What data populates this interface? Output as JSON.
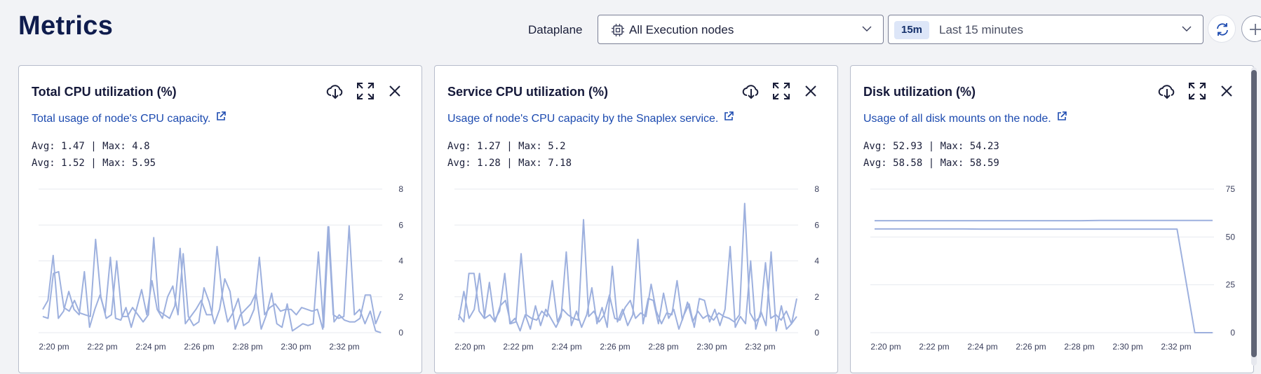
{
  "page": {
    "title": "Metrics"
  },
  "toolbar": {
    "dataplane_label": "Dataplane",
    "nodes_select": {
      "value": "All Execution nodes",
      "icon": "cpu-chip-icon"
    },
    "range_select": {
      "badge": "15m",
      "value": "Last 15 minutes"
    },
    "refresh_icon": "refresh-icon",
    "add_icon": "add-circle-icon"
  },
  "colors": {
    "line": "#9db0de",
    "grid": "#e7e9ef",
    "link": "#1d4bb0",
    "title": "#0f1c4d"
  },
  "cards": [
    {
      "title": "Total CPU utilization (%)",
      "description": "Total usage of node's CPU capacity.",
      "stats": [
        "Avg: 1.47 | Max: 4.8",
        "Avg: 1.52 | Max: 5.95"
      ],
      "tools": [
        "download-icon",
        "expand-icon",
        "close-icon"
      ]
    },
    {
      "title": "Service CPU utilization (%)",
      "description": "Usage of node's CPU capacity by the Snaplex service.",
      "stats": [
        "Avg: 1.27 | Max: 5.2",
        "Avg: 1.28 | Max: 7.18"
      ],
      "tools": [
        "download-icon",
        "expand-icon",
        "close-icon"
      ]
    },
    {
      "title": "Disk utilization (%)",
      "description": "Usage of all disk mounts on the node.",
      "stats": [
        "Avg: 52.93 | Max: 54.23",
        "Avg: 58.58 | Max: 58.59"
      ],
      "tools": [
        "download-icon",
        "expand-icon",
        "close-icon"
      ]
    }
  ],
  "chart_data": [
    {
      "type": "line",
      "x_ticks": [
        "2:20 pm",
        "2:22 pm",
        "2:24 pm",
        "2:26 pm",
        "2:28 pm",
        "2:30 pm",
        "2:32 pm"
      ],
      "y_ticks": [
        0,
        2,
        4,
        6,
        8
      ],
      "ylim": [
        0,
        8
      ],
      "series": [
        {
          "values": [
            0.9,
            0.8,
            3.3,
            3.4,
            1.4,
            1.2,
            1.8,
            1.1,
            1.0,
            0.9,
            5.2,
            2.0,
            0.8,
            1.0,
            4.0,
            0.9,
            0.9,
            1.4,
            1.0,
            0.6,
            1.0,
            5.3,
            1.2,
            1.0,
            0.8,
            1.5,
            4.7,
            0.5,
            0.9,
            1.3,
            1.8,
            1.0,
            1.0,
            4.8,
            2.0,
            0.6,
            1.1,
            1.9,
            0.4,
            0.6,
            1.3,
            4.2,
            1.0,
            1.4,
            1.6,
            1.2,
            1.3,
            1.3,
            1.0,
            1.4,
            1.3,
            1.2,
            1.3,
            0.2,
            5.9,
            1.0,
            0.8,
            0.9,
            5.95,
            1.0,
            1.3,
            0.5,
            1.2,
            0.1,
            0.0
          ]
        },
        {
          "values": [
            1.3,
            1.8,
            4.3,
            0.8,
            1.2,
            2.3,
            1.3,
            1.0,
            3.4,
            0.3,
            1.3,
            2.1,
            1.1,
            4.2,
            0.8,
            0.7,
            1.4,
            0.3,
            1.3,
            2.4,
            1.0,
            2.9,
            1.3,
            0.8,
            2.0,
            2.6,
            1.0,
            4.4,
            0.9,
            0.4,
            0.6,
            2.5,
            1.7,
            0.5,
            1.3,
            3.0,
            2.3,
            0.2,
            1.0,
            1.3,
            1.6,
            2.2,
            0.2,
            1.0,
            2.2,
            0.5,
            0.3,
            1.6,
            0.1,
            0.3,
            0.5,
            0.4,
            0.5,
            4.5,
            0.3,
            5.9,
            0.6,
            1.0,
            0.7,
            0.6,
            0.6,
            0.8,
            2.1,
            2.1,
            0.5,
            1.2
          ]
        }
      ]
    },
    {
      "type": "line",
      "x_ticks": [
        "2:20 pm",
        "2:22 pm",
        "2:24 pm",
        "2:26 pm",
        "2:28 pm",
        "2:30 pm",
        "2:32 pm"
      ],
      "y_ticks": [
        0,
        2,
        4,
        6,
        8
      ],
      "ylim": [
        0,
        8
      ],
      "series": [
        {
          "values": [
            0.7,
            2.3,
            0.8,
            1.3,
            3.3,
            0.8,
            1.0,
            0.6,
            1.5,
            1.8,
            0.5,
            0.6,
            4.4,
            1.0,
            0.8,
            0.7,
            1.2,
            0.9,
            2.9,
            0.6,
            1.3,
            1.0,
            0.8,
            0.7,
            6.3,
            0.9,
            1.2,
            0.6,
            1.0,
            2.1,
            0.8,
            0.7,
            1.4,
            1.8,
            0.8,
            1.1,
            0.9,
            2.7,
            1.2,
            0.5,
            1.1,
            1.0,
            2.9,
            0.7,
            1.7,
            0.6,
            1.2,
            0.8,
            1.0,
            0.7,
            1.1,
            0.9,
            0.8,
            0.6,
            1.0,
            7.2,
            1.1,
            0.6,
            0.9,
            3.9,
            0.8,
            1.0,
            0.7,
            1.2,
            0.5,
            0.9
          ]
        },
        {
          "values": [
            1.0,
            0.6,
            3.3,
            3.3,
            1.2,
            0.8,
            2.8,
            0.7,
            1.2,
            3.3,
            0.5,
            0.8,
            0.1,
            1.0,
            0.2,
            1.5,
            0.4,
            1.3,
            0.8,
            0.3,
            0.9,
            4.5,
            0.4,
            1.2,
            0.3,
            1.0,
            2.5,
            0.5,
            1.4,
            0.3,
            3.7,
            0.6,
            1.3,
            0.4,
            1.0,
            5.2,
            0.5,
            1.9,
            1.8,
            0.5,
            2.2,
            0.8,
            1.3,
            0.2,
            1.0,
            1.6,
            0.3,
            1.9,
            1.8,
            0.6,
            1.3,
            0.4,
            1.3,
            4.8,
            0.3,
            0.9,
            0.5,
            4.0,
            0.2,
            1.2,
            0.4,
            4.5,
            0.1,
            1.5,
            0.2,
            0.5,
            1.9
          ]
        }
      ]
    },
    {
      "type": "line",
      "x_ticks": [
        "2:20 pm",
        "2:22 pm",
        "2:24 pm",
        "2:26 pm",
        "2:28 pm",
        "2:30 pm",
        "2:32 pm"
      ],
      "y_ticks": [
        0,
        25,
        50,
        75
      ],
      "ylim": [
        0,
        75
      ],
      "series": [
        {
          "values": [
            58.5,
            58.5,
            58.5,
            58.5,
            58.5,
            58.5,
            58.5,
            58.5,
            58.5,
            58.5,
            58.5,
            58.5,
            58.6,
            58.6,
            58.6,
            58.6,
            58.6,
            58.6,
            58.6
          ]
        },
        {
          "values": [
            54.2,
            54.2,
            54.2,
            54.2,
            54.2,
            54.2,
            54.1,
            54.1,
            54.1,
            54.1,
            54.1,
            54.1,
            54.1,
            54.1,
            54.1,
            54.1,
            54.1,
            54.1,
            0.0,
            0.0
          ]
        }
      ]
    }
  ]
}
